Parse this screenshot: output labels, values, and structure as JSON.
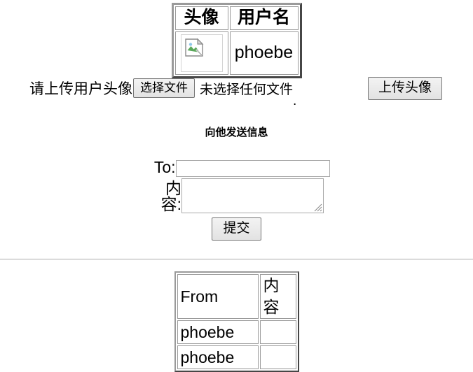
{
  "profile": {
    "headers": [
      "头像",
      "用户名"
    ],
    "avatar_alt": "broken-image",
    "username": "phoebe"
  },
  "upload": {
    "label": "请上传用户头像",
    "choose_file_label": "选择文件",
    "file_status": "未选择任何文件",
    "stray_text": ".",
    "submit_label": "上传头像"
  },
  "message_form": {
    "heading": "向他发送信息",
    "to_label": "To:",
    "to_value": "",
    "content_label": "内容:",
    "content_value": "",
    "submit_label": "提交"
  },
  "messages": {
    "headers": [
      "From",
      "内容"
    ],
    "rows": [
      {
        "from": "phoebe",
        "content": ""
      },
      {
        "from": "phoebe",
        "content": ""
      }
    ]
  },
  "colors": {
    "page_background": "#ffffff",
    "text": "#000000",
    "table_border": "#9a9a9a",
    "input_border": "#a9a9a9",
    "button_border": "#767676",
    "divider": "#bdbdbd"
  }
}
